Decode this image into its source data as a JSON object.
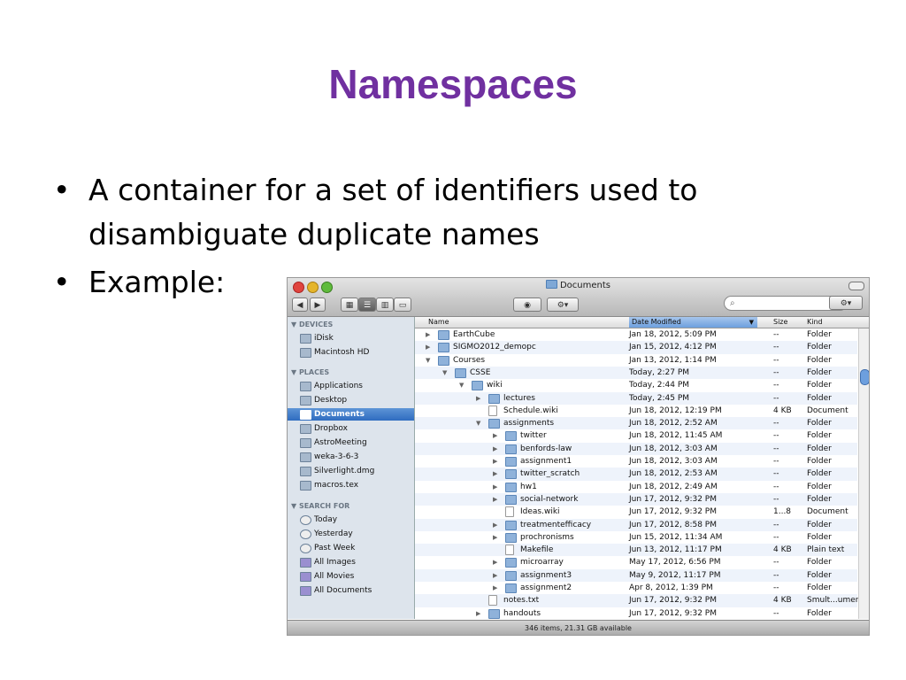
{
  "slide": {
    "title": "Namespaces",
    "bullets": [
      "A container for a set of identifiers used to disambiguate duplicate names",
      "Example:"
    ],
    "bullet_glyph": "•"
  },
  "finder": {
    "window_title": "Documents",
    "search_placeholder": "",
    "toolbar": {
      "back_label": "◀",
      "forward_label": "▶",
      "view_icons": "icon-view",
      "view_list": "list-view",
      "view_columns": "column-view",
      "view_coverflow": "coverflow-view",
      "quicklook_label": "👁",
      "action_label": "⚙▾",
      "dropbox_label": "▾"
    },
    "sidebar": {
      "devices_header": "▼ DEVICES",
      "devices": [
        "iDisk",
        "Macintosh HD"
      ],
      "places_header": "▼ PLACES",
      "places": [
        "Applications",
        "Desktop",
        "Documents",
        "Dropbox",
        "AstroMeeting",
        "weka-3-6-3",
        "Silverlight.dmg",
        "macros.tex"
      ],
      "selected": "Documents",
      "search_header": "▼ SEARCH FOR",
      "search_for": [
        "Today",
        "Yesterday",
        "Past Week",
        "All Images",
        "All Movies",
        "All Documents"
      ]
    },
    "columns": {
      "name": "Name",
      "date": "Date Modified",
      "size": "Size",
      "kind": "Kind"
    },
    "files": [
      {
        "name": "EarthCube",
        "date": "Jan 18, 2012, 5:09 PM",
        "size": "--",
        "kind": "Folder",
        "depth": 0,
        "tri": "▶",
        "folder": true
      },
      {
        "name": "SIGMO2012_demopc",
        "date": "Jan 15, 2012, 4:12 PM",
        "size": "--",
        "kind": "Folder",
        "depth": 0,
        "tri": "▶",
        "folder": true
      },
      {
        "name": "Courses",
        "date": "Jan 13, 2012, 1:14 PM",
        "size": "--",
        "kind": "Folder",
        "depth": 0,
        "tri": "▼",
        "folder": true
      },
      {
        "name": "CSSE",
        "date": "Today, 2:27 PM",
        "size": "--",
        "kind": "Folder",
        "depth": 1,
        "tri": "▼",
        "folder": true
      },
      {
        "name": "wiki",
        "date": "Today, 2:44 PM",
        "size": "--",
        "kind": "Folder",
        "depth": 2,
        "tri": "▼",
        "folder": true
      },
      {
        "name": "lectures",
        "date": "Today, 2:45 PM",
        "size": "--",
        "kind": "Folder",
        "depth": 3,
        "tri": "▶",
        "folder": true
      },
      {
        "name": "Schedule.wiki",
        "date": "Jun 18, 2012, 12:19 PM",
        "size": "4 KB",
        "kind": "Document",
        "depth": 3,
        "tri": "",
        "folder": false
      },
      {
        "name": "assignments",
        "date": "Jun 18, 2012, 2:52 AM",
        "size": "--",
        "kind": "Folder",
        "depth": 3,
        "tri": "▼",
        "folder": true
      },
      {
        "name": "twitter",
        "date": "Jun 18, 2012, 11:45 AM",
        "size": "--",
        "kind": "Folder",
        "depth": 4,
        "tri": "▶",
        "folder": true
      },
      {
        "name": "benfords-law",
        "date": "Jun 18, 2012, 3:03 AM",
        "size": "--",
        "kind": "Folder",
        "depth": 4,
        "tri": "▶",
        "folder": true
      },
      {
        "name": "assignment1",
        "date": "Jun 18, 2012, 3:03 AM",
        "size": "--",
        "kind": "Folder",
        "depth": 4,
        "tri": "▶",
        "folder": true
      },
      {
        "name": "twitter_scratch",
        "date": "Jun 18, 2012, 2:53 AM",
        "size": "--",
        "kind": "Folder",
        "depth": 4,
        "tri": "▶",
        "folder": true
      },
      {
        "name": "hw1",
        "date": "Jun 18, 2012, 2:49 AM",
        "size": "--",
        "kind": "Folder",
        "depth": 4,
        "tri": "▶",
        "folder": true
      },
      {
        "name": "social-network",
        "date": "Jun 17, 2012, 9:32 PM",
        "size": "--",
        "kind": "Folder",
        "depth": 4,
        "tri": "▶",
        "folder": true
      },
      {
        "name": "Ideas.wiki",
        "date": "Jun 17, 2012, 9:32 PM",
        "size": "1...8",
        "kind": "Document",
        "depth": 4,
        "tri": "",
        "folder": false
      },
      {
        "name": "treatmentefficacy",
        "date": "Jun 17, 2012, 8:58 PM",
        "size": "--",
        "kind": "Folder",
        "depth": 4,
        "tri": "▶",
        "folder": true
      },
      {
        "name": "prochronisms",
        "date": "Jun 15, 2012, 11:34 AM",
        "size": "--",
        "kind": "Folder",
        "depth": 4,
        "tri": "▶",
        "folder": true
      },
      {
        "name": "Makefile",
        "date": "Jun 13, 2012, 11:17 PM",
        "size": "4 KB",
        "kind": "Plain text",
        "depth": 4,
        "tri": "",
        "folder": false
      },
      {
        "name": "microarray",
        "date": "May 17, 2012, 6:56 PM",
        "size": "--",
        "kind": "Folder",
        "depth": 4,
        "tri": "▶",
        "folder": true
      },
      {
        "name": "assignment3",
        "date": "May 9, 2012, 11:17 PM",
        "size": "--",
        "kind": "Folder",
        "depth": 4,
        "tri": "▶",
        "folder": true
      },
      {
        "name": "assignment2",
        "date": "Apr 8, 2012, 1:39 PM",
        "size": "--",
        "kind": "Folder",
        "depth": 4,
        "tri": "▶",
        "folder": true
      },
      {
        "name": "notes.txt",
        "date": "Jun 17, 2012, 9:32 PM",
        "size": "4 KB",
        "kind": "Smult...ument",
        "depth": 3,
        "tri": "",
        "folder": false
      },
      {
        "name": "handouts",
        "date": "Jun 17, 2012, 9:32 PM",
        "size": "--",
        "kind": "Folder",
        "depth": 3,
        "tri": "▶",
        "folder": true
      }
    ],
    "status": "346 items, 21.31 GB available"
  }
}
